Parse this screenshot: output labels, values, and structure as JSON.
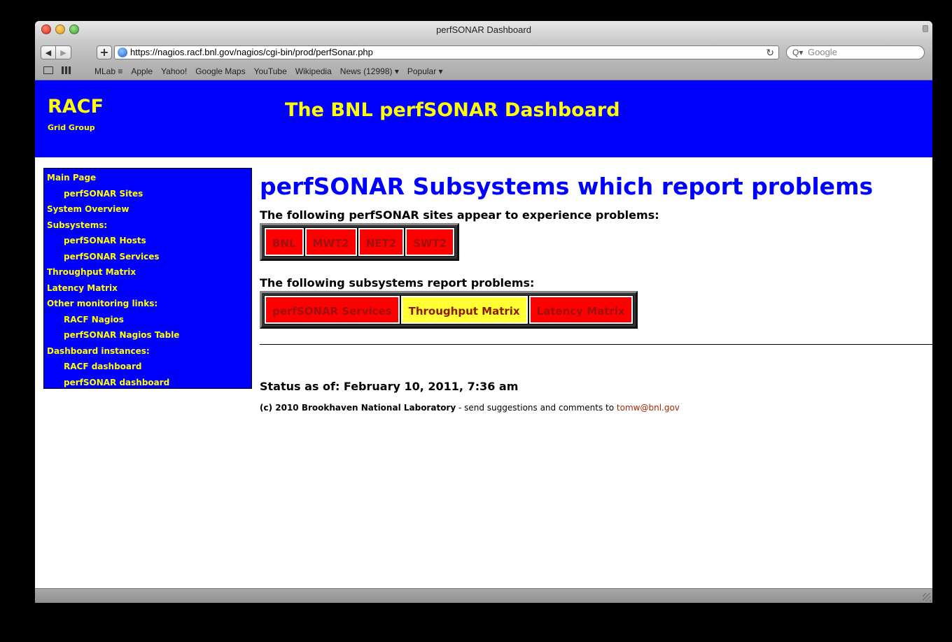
{
  "browser": {
    "window_title": "perfSONAR Dashboard",
    "url": "https://nagios.racf.bnl.gov/nagios/cgi-bin/prod/perfSonar.php",
    "search_placeholder": "Google",
    "back_glyph": "◀",
    "forward_glyph": "▶",
    "add_glyph": "+",
    "reload_glyph": "↻",
    "search_glyph": "Q▾",
    "bookmarks": [
      "MLab ≡",
      "Apple",
      "Yahoo!",
      "Google Maps",
      "YouTube",
      "Wikipedia",
      "News (12998) ▾",
      "Popular ▾"
    ]
  },
  "banner": {
    "logo": "RACF",
    "logo_sub": "Grid Group",
    "title": "The BNL perfSONAR Dashboard",
    "background": "#0000ff",
    "text_color": "#ffff00"
  },
  "sidebar": {
    "items": [
      {
        "label": "Main Page",
        "indent": false
      },
      {
        "label": "perfSONAR Sites",
        "indent": true
      },
      {
        "label": "System Overview",
        "indent": false
      },
      {
        "label": "Subsystems:",
        "indent": false
      },
      {
        "label": "perfSONAR Hosts",
        "indent": true
      },
      {
        "label": "perfSONAR Services",
        "indent": true
      },
      {
        "label": "Throughput Matrix",
        "indent": false
      },
      {
        "label": "Latency Matrix",
        "indent": false
      },
      {
        "label": "Other monitoring links:",
        "indent": false
      },
      {
        "label": "RACF Nagios",
        "indent": true
      },
      {
        "label": "perfSONAR Nagios Table",
        "indent": true
      },
      {
        "label": "Dashboard instances:",
        "indent": false
      },
      {
        "label": "RACF dashboard",
        "indent": true
      },
      {
        "label": "perfSONAR dashboard",
        "indent": true
      }
    ]
  },
  "main": {
    "heading": "perfSONAR Subsystems which report problems",
    "sites_label": "The following perfSONAR sites appear to experience problems:",
    "sites": [
      {
        "label": "BNL",
        "status": "red"
      },
      {
        "label": "MWT2",
        "status": "red"
      },
      {
        "label": "NET2",
        "status": "red"
      },
      {
        "label": "SWT2",
        "status": "red"
      }
    ],
    "subsystems_label": "The following subsystems report problems:",
    "subsystems": [
      {
        "label": "perfSONAR Services",
        "status": "red"
      },
      {
        "label": "Throughput Matrix",
        "status": "yellow"
      },
      {
        "label": "Latency Matrix",
        "status": "red"
      }
    ],
    "status_line": "Status as of: February 10, 2011, 7:36 am",
    "footer_org": "(c) 2010 Brookhaven National Laboratory",
    "footer_text": " - send suggestions and comments to ",
    "footer_email": "tomw@bnl.gov"
  }
}
